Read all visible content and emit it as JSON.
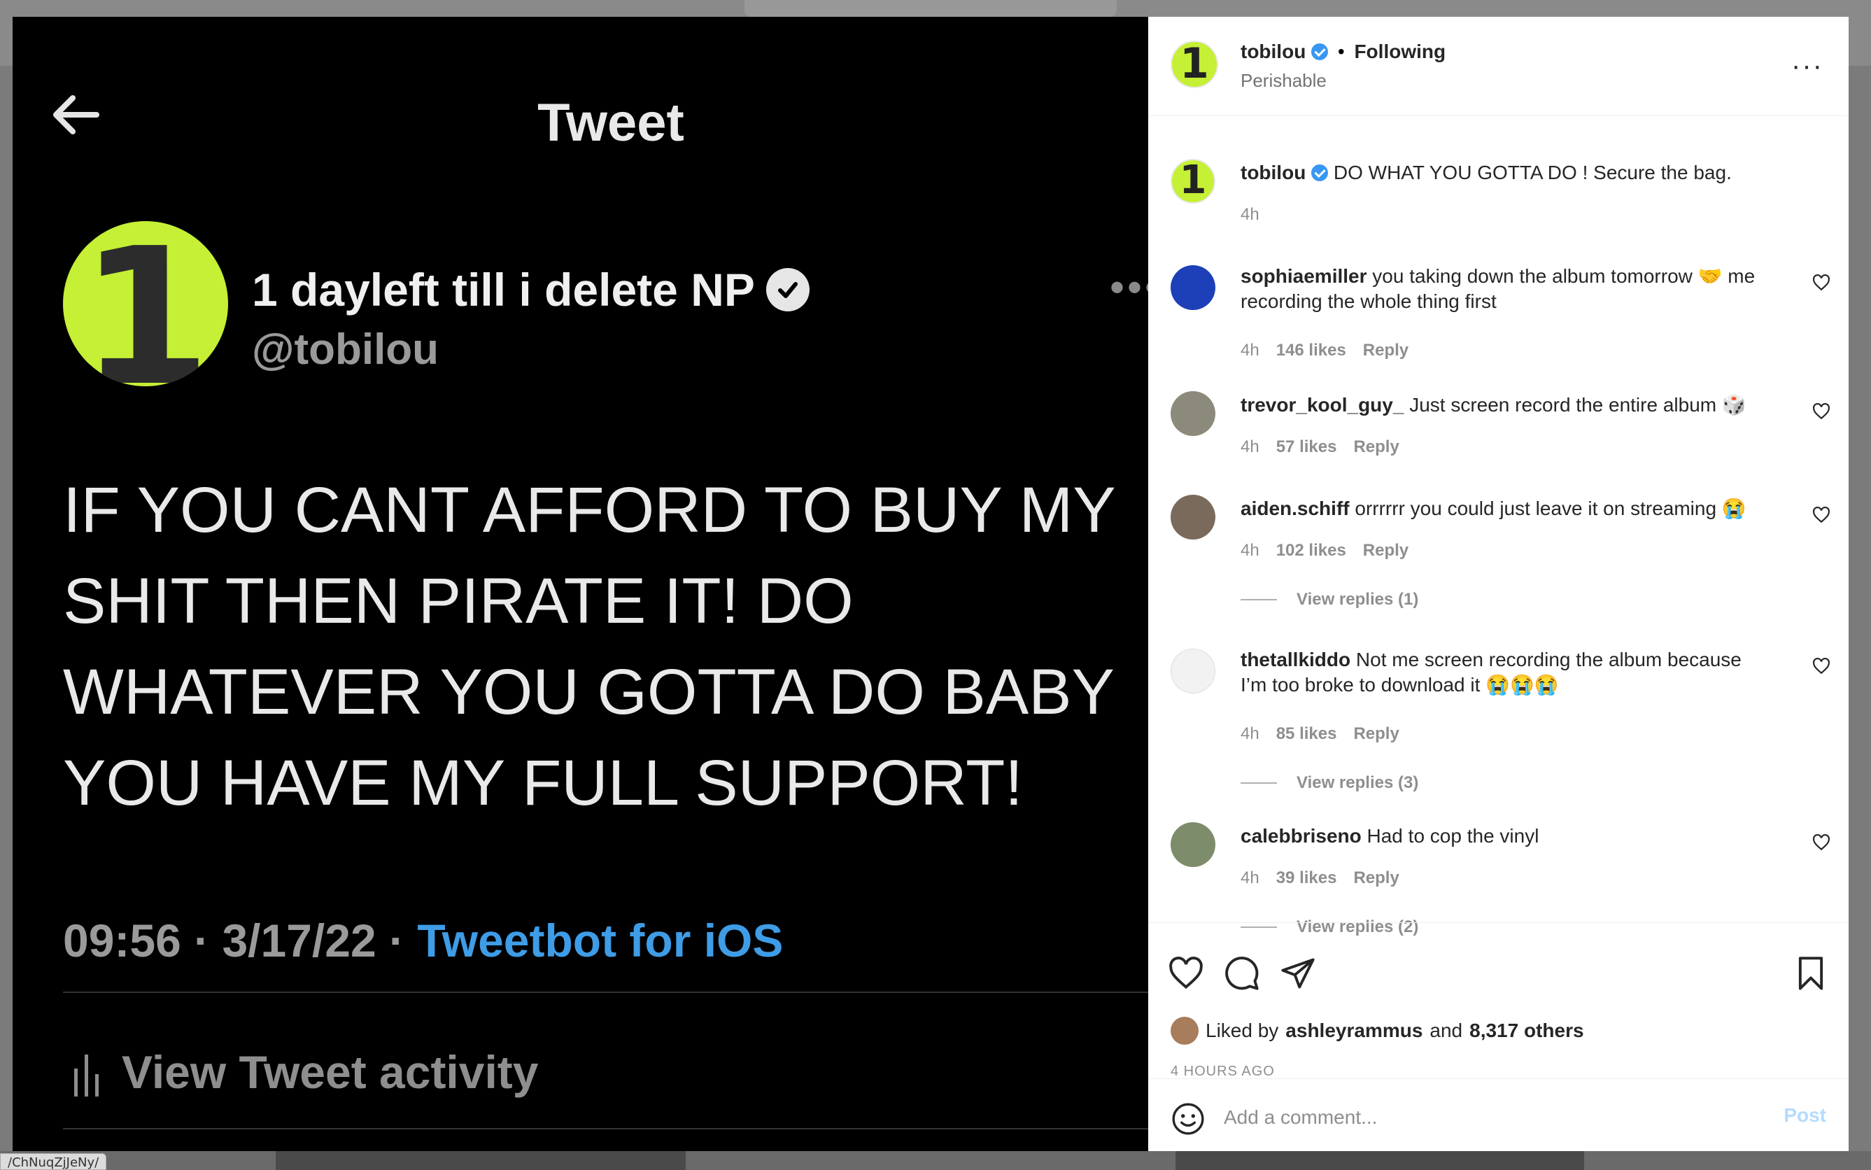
{
  "status_url": "/ChNuqZjJeNy/",
  "tweet": {
    "header": "Tweet",
    "avatar_digit": "1",
    "display_name": "1 dayleft till i delete NP",
    "handle": "@tobilou",
    "body": "IF YOU CANT AFFORD TO BUY MY SHIT THEN PIRATE IT! DO WHATEVER YOU GOTTA DO BABY YOU HAVE MY FULL SUPPORT!",
    "timestamp": "09:56 · 3/17/22 · ",
    "source": "Tweetbot for iOS",
    "activity": "View Tweet activity"
  },
  "post": {
    "author": "tobilou",
    "avatar_digit": "1",
    "follow_state": "Following",
    "separator": "•",
    "subtitle": "Perishable",
    "more": "···",
    "caption": "DO WHAT YOU GOTTA DO ! Secure the bag.",
    "caption_time": "4h"
  },
  "comments": [
    {
      "user": "sophiaemiller",
      "text": "you taking down the album tomorrow 🤝 me recording the whole thing first",
      "time": "4h",
      "likes": "146 likes",
      "reply": "Reply",
      "avatar_color": "#1d3fb8"
    },
    {
      "user": "trevor_kool_guy_",
      "text": "Just screen record the entire album 🎲",
      "time": "4h",
      "likes": "57 likes",
      "reply": "Reply",
      "avatar_color": "#8c8a7a"
    },
    {
      "user": "aiden.schiff",
      "text": "orrrrrr you could just leave it on streaming 😭",
      "time": "4h",
      "likes": "102 likes",
      "reply": "Reply",
      "view_replies": "View replies (1)",
      "avatar_color": "#7a6a5c"
    },
    {
      "user": "thetallkiddo",
      "text": "Not me screen recording the album because I’m too broke to download it 😭😭😭",
      "time": "4h",
      "likes": "85 likes",
      "reply": "Reply",
      "view_replies": "View replies (3)",
      "avatar_color": "#f2f2f2"
    },
    {
      "user": "calebbriseno",
      "text": "Had to cop the vinyl",
      "time": "4h",
      "likes": "39 likes",
      "reply": "Reply",
      "view_replies": "View replies (2)",
      "avatar_color": "#7d8c6a"
    }
  ],
  "likes": {
    "prefix": "Liked by",
    "user": "ashleyrammus",
    "middle": "and",
    "others": "8,317 others",
    "ago": "4 HOURS AGO"
  },
  "comment_box": {
    "placeholder": "Add a comment...",
    "post_label": "Post"
  },
  "colors": {
    "avatar_lime": "#c5f035",
    "tweet_link": "#3f9ce6",
    "verified": "#3897f0",
    "post_disabled": "#b3dbff"
  }
}
